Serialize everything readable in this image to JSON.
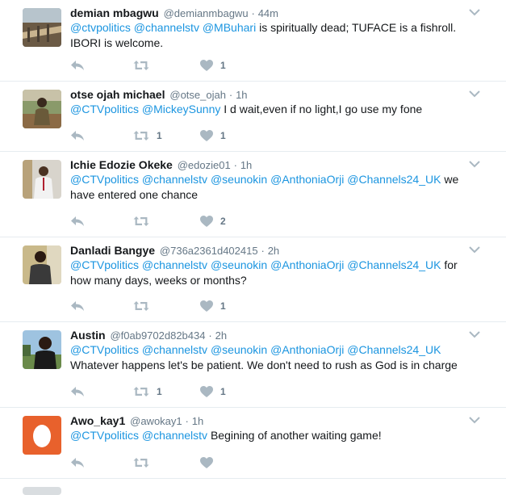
{
  "colors": {
    "link": "#1b95e0",
    "muted": "#657786",
    "icon": "#aab8c2",
    "divider": "#e6ecf0"
  },
  "icons": {
    "reply": "reply-icon",
    "retweet": "retweet-icon",
    "like": "heart-icon",
    "more": "chevron-down-icon"
  },
  "tweets": [
    {
      "fullname": "demian mbagwu",
      "screenname": "@demianmbagwu",
      "time": "44m",
      "segments": [
        {
          "text": "@ctvpolitics",
          "link": true
        },
        {
          "text": " ",
          "link": false
        },
        {
          "text": "@channelstv",
          "link": true
        },
        {
          "text": " ",
          "link": false
        },
        {
          "text": "@MBuhari",
          "link": true
        },
        {
          "text": " is spiritually dead; TUFACE is a fishroll. IBORI is welcome.",
          "link": false
        }
      ],
      "retweets": "",
      "likes": "1"
    },
    {
      "fullname": "otse ojah michael",
      "screenname": "@otse_ojah",
      "time": "1h",
      "segments": [
        {
          "text": "@CTVpolitics",
          "link": true
        },
        {
          "text": " ",
          "link": false
        },
        {
          "text": "@MickeySunny",
          "link": true
        },
        {
          "text": " I d wait,even if no light,I go use my fone",
          "link": false
        }
      ],
      "retweets": "1",
      "likes": "1"
    },
    {
      "fullname": "Ichie Edozie Okeke",
      "screenname": "@edozie01",
      "time": "1h",
      "segments": [
        {
          "text": "@CTVpolitics",
          "link": true
        },
        {
          "text": " ",
          "link": false
        },
        {
          "text": "@channelstv",
          "link": true
        },
        {
          "text": " ",
          "link": false
        },
        {
          "text": "@seunokin",
          "link": true
        },
        {
          "text": " ",
          "link": false
        },
        {
          "text": "@AnthoniaOrji",
          "link": true
        },
        {
          "text": " ",
          "link": false
        },
        {
          "text": "@Channels24_UK",
          "link": true
        },
        {
          "text": " we have entered one chance",
          "link": false
        }
      ],
      "retweets": "",
      "likes": "2"
    },
    {
      "fullname": "Danladi Bangye",
      "screenname": "@736a2361d402415",
      "time": "2h",
      "segments": [
        {
          "text": "@CTVpolitics",
          "link": true
        },
        {
          "text": " ",
          "link": false
        },
        {
          "text": "@channelstv",
          "link": true
        },
        {
          "text": " ",
          "link": false
        },
        {
          "text": "@seunokin",
          "link": true
        },
        {
          "text": " ",
          "link": false
        },
        {
          "text": "@AnthoniaOrji",
          "link": true
        },
        {
          "text": " ",
          "link": false
        },
        {
          "text": "@Channels24_UK",
          "link": true
        },
        {
          "text": " for how many days, weeks or months?",
          "link": false
        }
      ],
      "retweets": "",
      "likes": "1"
    },
    {
      "fullname": "Austin",
      "screenname": "@f0ab9702d82b434",
      "time": "2h",
      "segments": [
        {
          "text": "@CTVpolitics",
          "link": true
        },
        {
          "text": " ",
          "link": false
        },
        {
          "text": "@channelstv",
          "link": true
        },
        {
          "text": " ",
          "link": false
        },
        {
          "text": "@seunokin",
          "link": true
        },
        {
          "text": " ",
          "link": false
        },
        {
          "text": "@AnthoniaOrji",
          "link": true
        },
        {
          "text": " ",
          "link": false
        },
        {
          "text": "@Channels24_UK",
          "link": true
        },
        {
          "text": " Whatever happens let's be patient. We don't need to rush as God is in charge",
          "link": false
        }
      ],
      "retweets": "1",
      "likes": "1"
    },
    {
      "fullname": "Awo_kay1",
      "screenname": "@awokay1",
      "time": "1h",
      "segments": [
        {
          "text": "@CTVpolitics",
          "link": true
        },
        {
          "text": " ",
          "link": false
        },
        {
          "text": "@channelstv",
          "link": true
        },
        {
          "text": " Begining of another waiting game!",
          "link": false
        }
      ],
      "retweets": "",
      "likes": ""
    }
  ]
}
